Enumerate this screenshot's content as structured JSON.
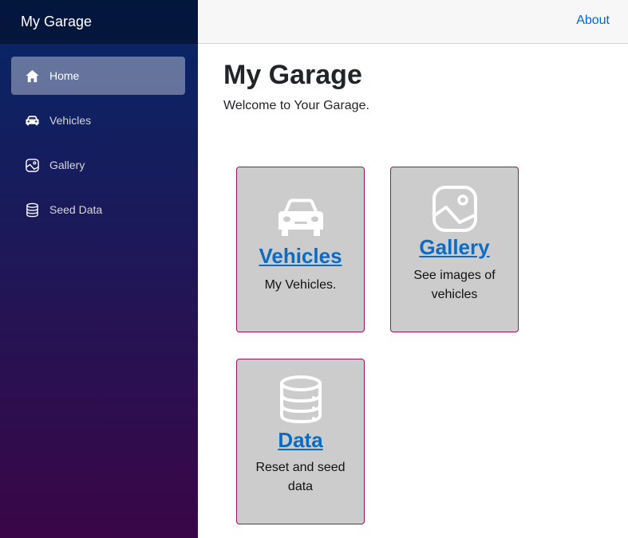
{
  "app": {
    "title": "My Garage"
  },
  "sidebar": {
    "items": [
      {
        "label": "Home",
        "icon": "home-icon",
        "active": true
      },
      {
        "label": "Vehicles",
        "icon": "car-icon",
        "active": false
      },
      {
        "label": "Gallery",
        "icon": "image-icon",
        "active": false
      },
      {
        "label": "Seed Data",
        "icon": "database-icon",
        "active": false
      }
    ]
  },
  "topbar": {
    "about_label": "About"
  },
  "main": {
    "title": "My Garage",
    "subtitle": "Welcome to Your Garage.",
    "cards": [
      {
        "title": "Vehicles",
        "description": "My Vehicles.",
        "icon": "car-icon"
      },
      {
        "title": "Gallery",
        "description": "See images of vehicles",
        "icon": "image-icon"
      },
      {
        "title": "Data",
        "description": "Reset and seed data",
        "icon": "database-icon"
      }
    ]
  },
  "colors": {
    "sidebar_top": "#052767",
    "sidebar_bottom": "#3a0647",
    "card_bg": "#cccccc",
    "card_border": "#a0105e",
    "link": "#0a6cc4"
  }
}
